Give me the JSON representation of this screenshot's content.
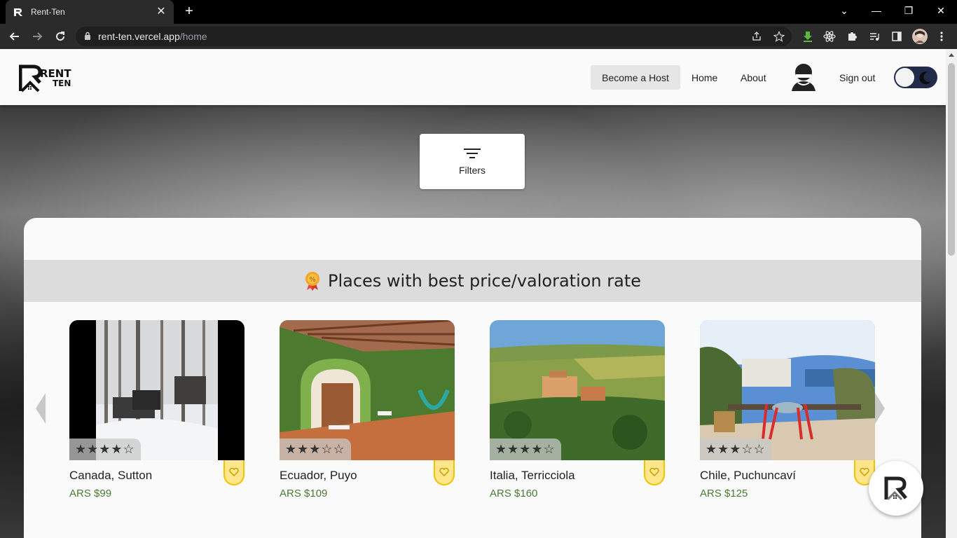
{
  "browser": {
    "tab_title": "Rent-Ten",
    "url_host": "rent-ten.vercel.app",
    "url_path": "/home"
  },
  "header": {
    "logo_text_top": "RENT",
    "logo_text_bottom": "TEN",
    "nav": {
      "become_host": "Become a Host",
      "home": "Home",
      "about": "About",
      "sign_out": "Sign out"
    },
    "dark_mode": false
  },
  "filters": {
    "label": "Filters"
  },
  "section": {
    "title": "Places with best price/valoration rate"
  },
  "cards": [
    {
      "place": "Canada, Sutton",
      "price": "ARS $99",
      "stars": "★★★★☆"
    },
    {
      "place": "Ecuador, Puyo",
      "price": "ARS $109",
      "stars": "★★★☆☆"
    },
    {
      "place": "Italia, Terricciola",
      "price": "ARS $160",
      "stars": "★★★★☆"
    },
    {
      "place": "Chile, Puchuncaví",
      "price": "ARS $125",
      "stars": "★★★☆☆"
    }
  ],
  "colors": {
    "accent_yellow": "#ffe68a",
    "price_green": "#4a7a34",
    "toggle_dark": "#222c4a"
  }
}
